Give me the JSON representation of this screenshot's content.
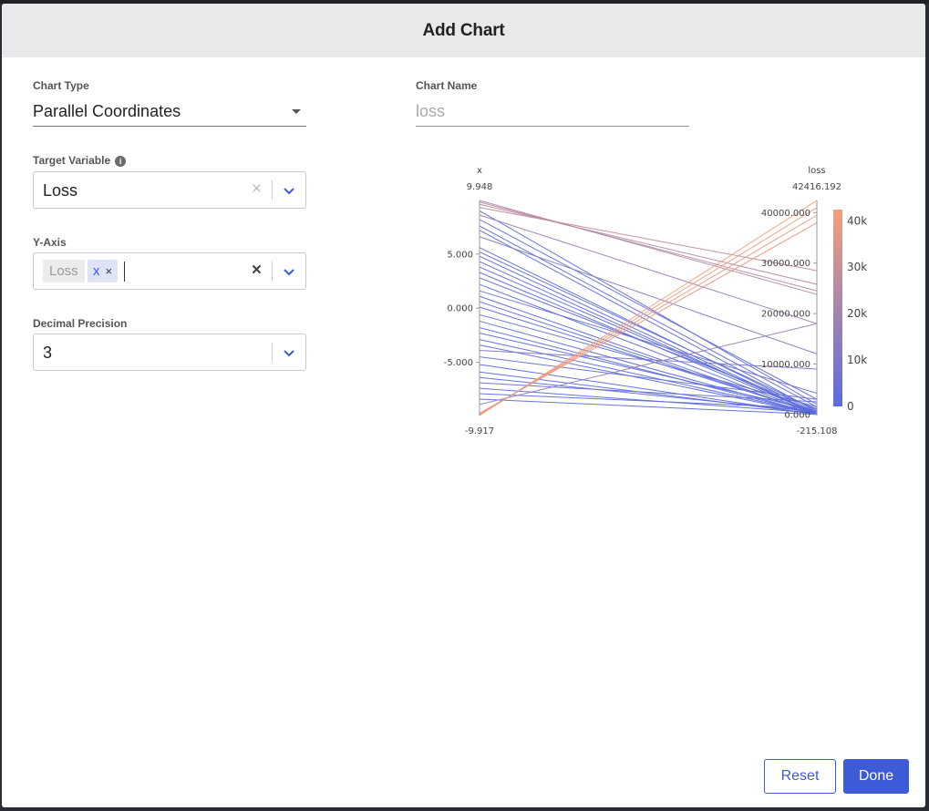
{
  "modal": {
    "title": "Add Chart"
  },
  "form": {
    "chart_type": {
      "label": "Chart Type",
      "value": "Parallel Coordinates"
    },
    "chart_name": {
      "label": "Chart Name",
      "placeholder": "loss"
    },
    "target_variable": {
      "label": "Target Variable",
      "value": "Loss",
      "info_icon": "info-icon"
    },
    "y_axis": {
      "label": "Y-Axis",
      "chips": [
        "Loss",
        "x"
      ],
      "chip_remove": "×",
      "clear": "×"
    },
    "decimal_precision": {
      "label": "Decimal Precision",
      "value": "3"
    }
  },
  "chart_data": {
    "type": "line",
    "axes": [
      {
        "name": "x",
        "max": 9.948,
        "min": -9.917,
        "ticks": [
          "5.000",
          "0.000",
          "-5.000"
        ],
        "tick_values": [
          5,
          0,
          -5
        ],
        "max_label": "9.948",
        "min_label": "-9.917"
      },
      {
        "name": "loss",
        "max": 42416.192,
        "min": -215.108,
        "ticks": [
          "40000.000",
          "30000.000",
          "20000.000",
          "10000.000",
          "0.000"
        ],
        "tick_values": [
          40000,
          30000,
          20000,
          10000,
          0
        ],
        "max_label": "42416.192",
        "min_label": "-215.108"
      }
    ],
    "colorbar": {
      "ticks": [
        "40k",
        "30k",
        "20k",
        "10k",
        "0"
      ],
      "tick_values": [
        40000,
        30000,
        20000,
        10000,
        0
      ],
      "color_low": "#5b6be0",
      "color_high": "#f4a07a",
      "range": [
        0,
        42416.192
      ]
    },
    "lines": [
      [
        9.948,
        23800
      ],
      [
        9.8,
        24500
      ],
      [
        9.6,
        25800
      ],
      [
        9.3,
        28500
      ],
      [
        9.0,
        2000
      ],
      [
        8.6,
        18000
      ],
      [
        8.2,
        3000
      ],
      [
        7.6,
        1500
      ],
      [
        7.2,
        600
      ],
      [
        6.6,
        12000
      ],
      [
        5.6,
        400
      ],
      [
        5.2,
        900
      ],
      [
        4.8,
        150
      ],
      [
        4.3,
        50
      ],
      [
        3.8,
        300
      ],
      [
        3.3,
        120
      ],
      [
        2.8,
        1100
      ],
      [
        2.2,
        30
      ],
      [
        1.6,
        4200
      ],
      [
        1.1,
        10
      ],
      [
        0.6,
        60
      ],
      [
        0.1,
        250
      ],
      [
        -0.6,
        1500
      ],
      [
        -1.2,
        20
      ],
      [
        -1.8,
        5
      ],
      [
        -2.3,
        700
      ],
      [
        -2.9,
        140
      ],
      [
        -3.4,
        40
      ],
      [
        -3.9,
        9000
      ],
      [
        -4.5,
        3000
      ],
      [
        -5.2,
        15
      ],
      [
        -5.9,
        90
      ],
      [
        -6.4,
        500
      ],
      [
        -6.9,
        2500
      ],
      [
        -7.4,
        300
      ],
      [
        -7.9,
        1200
      ],
      [
        -8.4,
        5
      ],
      [
        -8.9,
        18000
      ],
      [
        -9.917,
        42416.192
      ],
      [
        -9.85,
        41000
      ],
      [
        -9.78,
        39500
      ],
      [
        -9.7,
        38000
      ]
    ]
  },
  "footer": {
    "reset_label": "Reset",
    "done_label": "Done"
  }
}
